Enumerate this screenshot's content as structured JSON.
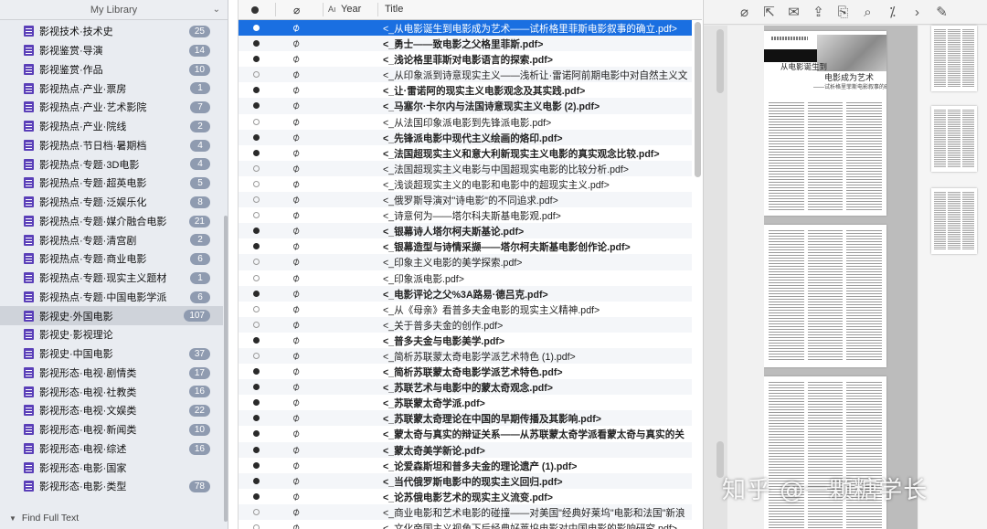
{
  "library": {
    "title": "My Library"
  },
  "collections": [
    {
      "label": "影视技术·技术史",
      "count": "25"
    },
    {
      "label": "影视鉴赏·导演",
      "count": "14"
    },
    {
      "label": "影视鉴赏·作品",
      "count": "10"
    },
    {
      "label": "影视热点·产业·票房",
      "count": "1"
    },
    {
      "label": "影视热点·产业·艺术影院",
      "count": "7"
    },
    {
      "label": "影视热点·产业·院线",
      "count": "2"
    },
    {
      "label": "影视热点·节日档·暑期档",
      "count": "4"
    },
    {
      "label": "影视热点·专题·3D电影",
      "count": "4"
    },
    {
      "label": "影视热点·专题·超英电影",
      "count": "5"
    },
    {
      "label": "影视热点·专题·泛娱乐化",
      "count": "8"
    },
    {
      "label": "影视热点·专题·媒介融合电影",
      "count": "21"
    },
    {
      "label": "影视热点·专题·清宫剧",
      "count": "2"
    },
    {
      "label": "影视热点·专题·商业电影",
      "count": "6"
    },
    {
      "label": "影视热点·专题·现实主义题材",
      "count": "1"
    },
    {
      "label": "影视热点·专题·中国电影学派",
      "count": "6"
    },
    {
      "label": "影视史·外国电影",
      "count": "107",
      "selected": true
    },
    {
      "label": "影视史·影视理论",
      "count": ""
    },
    {
      "label": "影视史·中国电影",
      "count": "37"
    },
    {
      "label": "影视形态·电视·剧情类",
      "count": "17"
    },
    {
      "label": "影视形态·电视·社教类",
      "count": "16"
    },
    {
      "label": "影视形态·电视·文娱类",
      "count": "22"
    },
    {
      "label": "影视形态·电视·新闻类",
      "count": "10"
    },
    {
      "label": "影视形态·电视·综述",
      "count": "16"
    },
    {
      "label": "影视形态·电影·国家",
      "count": ""
    },
    {
      "label": "影视形态·电影·类型",
      "count": "78"
    }
  ],
  "sidebar_footer": {
    "find_full_text": "Find Full Text"
  },
  "columns": {
    "author_icon": "Aı",
    "year": "Year",
    "title": "Title"
  },
  "items": [
    {
      "title": "<_从电影诞生到电影成为艺术——试析格里菲斯电影叙事的确立.pdf>",
      "read": true,
      "bold": false,
      "selected": true
    },
    {
      "title": "<_勇士——致电影之父格里菲斯.pdf>",
      "read": true,
      "bold": true
    },
    {
      "title": "<_浅论格里菲斯对电影语言的探索.pdf>",
      "read": true,
      "bold": true
    },
    {
      "title": "<_从印象派到诗意现实主义——浅析让·雷诺阿前期电影中对自然主义文",
      "read": false,
      "bold": false
    },
    {
      "title": "<_让·雷诺阿的现实主义电影观念及其实践.pdf>",
      "read": true,
      "bold": true
    },
    {
      "title": "<_马塞尔·卡尔内与法国诗意现实主义电影 (2).pdf>",
      "read": true,
      "bold": true
    },
    {
      "title": "<_从法国印象派电影到先锋派电影.pdf>",
      "read": false,
      "bold": false
    },
    {
      "title": "<_先锋派电影中现代主义绘画的烙印.pdf>",
      "read": true,
      "bold": true
    },
    {
      "title": "<_法国超现实主义和意大利新现实主义电影的真实观念比较.pdf>",
      "read": true,
      "bold": true
    },
    {
      "title": "<_法国超现实主义电影与中国超现实电影的比较分析.pdf>",
      "read": false,
      "bold": false
    },
    {
      "title": "<_浅谈超现实主义的电影和电影中的超现实主义.pdf>",
      "read": false,
      "bold": false
    },
    {
      "title": "<_俄罗斯导演对\"诗电影\"的不同追求.pdf>",
      "read": false,
      "bold": false
    },
    {
      "title": "<_诗意何为——塔尔科夫斯基电影观.pdf>",
      "read": false,
      "bold": false
    },
    {
      "title": "<_银幕诗人塔尔柯夫斯基论.pdf>",
      "read": true,
      "bold": true
    },
    {
      "title": "<_银幕造型与诗情采撷——塔尔柯夫斯基电影创作论.pdf>",
      "read": true,
      "bold": true
    },
    {
      "title": "<_印象主义电影的美学探索.pdf>",
      "read": false,
      "bold": false
    },
    {
      "title": "<_印象派电影.pdf>",
      "read": false,
      "bold": false
    },
    {
      "title": "<_电影评论之父%3A路易·德吕克.pdf>",
      "read": true,
      "bold": true
    },
    {
      "title": "<_从《母亲》看普多夫金电影的现实主义精神.pdf>",
      "read": false,
      "bold": false
    },
    {
      "title": "<_关于普多夫金的创作.pdf>",
      "read": false,
      "bold": false
    },
    {
      "title": "<_普多夫金与电影美学.pdf>",
      "read": true,
      "bold": true
    },
    {
      "title": "<_简析苏联蒙太奇电影学派艺术特色 (1).pdf>",
      "read": false,
      "bold": false
    },
    {
      "title": "<_简析苏联蒙太奇电影学派艺术特色.pdf>",
      "read": true,
      "bold": true
    },
    {
      "title": "<_苏联艺术与电影中的蒙太奇观念.pdf>",
      "read": true,
      "bold": true
    },
    {
      "title": "<_苏联蒙太奇学派.pdf>",
      "read": true,
      "bold": true
    },
    {
      "title": "<_苏联蒙太奇理论在中国的早期传播及其影响.pdf>",
      "read": true,
      "bold": true
    },
    {
      "title": "<_蒙太奇与真实的辩证关系——从苏联蒙太奇学派看蒙太奇与真实的关",
      "read": true,
      "bold": true
    },
    {
      "title": "<_蒙太奇美学新论.pdf>",
      "read": true,
      "bold": true
    },
    {
      "title": "<_论爱森斯坦和普多夫金的理论遗产 (1).pdf>",
      "read": true,
      "bold": true
    },
    {
      "title": "<_当代俄罗斯电影中的现实主义回归.pdf>",
      "read": true,
      "bold": true
    },
    {
      "title": "<_论苏俄电影艺术的现实主义流变.pdf>",
      "read": true,
      "bold": true
    },
    {
      "title": "<_商业电影和艺术电影的碰撞——对美国\"经典好莱坞\"电影和法国\"新浪",
      "read": false,
      "bold": false
    },
    {
      "title": "<_文化帝国主义视角下后经典好莱坞电影对中国电影的影响研究.pdf>",
      "read": false,
      "bold": false
    }
  ],
  "reader": {
    "toolbar_icons": [
      "attachment-icon",
      "open-external-icon",
      "email-icon",
      "export-icon",
      "import-icon",
      "search-icon",
      "annotation-icon",
      "next-icon",
      "edit-icon"
    ],
    "page1": {
      "title_a": "从电影诞生到",
      "title_b": "电影成为艺术",
      "subtitle": "——试析格里菲斯电影叙事的确立"
    }
  },
  "watermark": "知乎 @一颗糖学长"
}
